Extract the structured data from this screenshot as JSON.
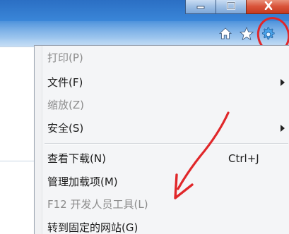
{
  "window": {
    "caption_buttons": [
      {
        "name": "minimize-button",
        "icon": "minimize-icon"
      },
      {
        "name": "maximize-button",
        "icon": "maximize-icon"
      },
      {
        "name": "close-button",
        "icon": "close-icon"
      }
    ],
    "toolbar_icons": [
      "home-icon",
      "star-icon",
      "gear-icon"
    ]
  },
  "menu": {
    "items": [
      {
        "label": "打印(P)",
        "enabled": false,
        "submenu": false,
        "shortcut": ""
      },
      {
        "label": "文件(F)",
        "enabled": true,
        "submenu": true,
        "shortcut": ""
      },
      {
        "label": "缩放(Z)",
        "enabled": false,
        "submenu": false,
        "shortcut": ""
      },
      {
        "label": "安全(S)",
        "enabled": true,
        "submenu": true,
        "shortcut": ""
      },
      {
        "label": "查看下载(N)",
        "enabled": true,
        "submenu": false,
        "shortcut": "Ctrl+J"
      },
      {
        "label": "管理加载项(M)",
        "enabled": true,
        "submenu": false,
        "shortcut": ""
      },
      {
        "label": "F12 开发人员工具(L)",
        "enabled": false,
        "submenu": false,
        "shortcut": ""
      },
      {
        "label": "转到固定的网站(G)",
        "enabled": true,
        "submenu": false,
        "shortcut": ""
      }
    ]
  },
  "colors": {
    "annotation": "#e0272a",
    "chrome_blue": "#3a86d8",
    "disabled_text": "#8b8b8b",
    "menu_bg": "#f4f5f7"
  }
}
